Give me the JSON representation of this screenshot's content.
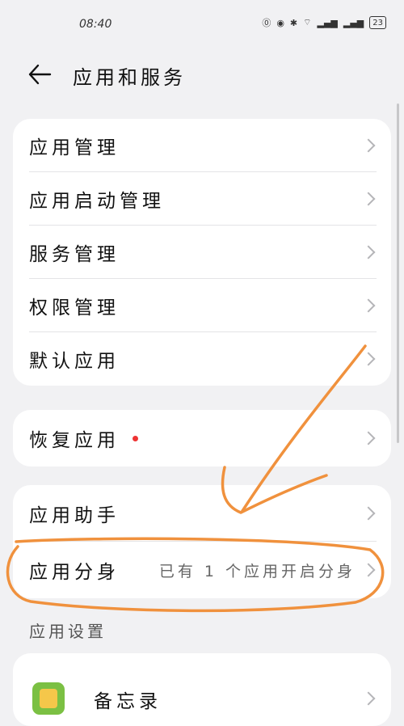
{
  "status": {
    "time": "08:40",
    "battery": "23"
  },
  "header": {
    "title": "应用和服务"
  },
  "group1": [
    {
      "label": "应用管理"
    },
    {
      "label": "应用启动管理"
    },
    {
      "label": "服务管理"
    },
    {
      "label": "权限管理"
    },
    {
      "label": "默认应用"
    }
  ],
  "group2": [
    {
      "label": "恢复应用"
    }
  ],
  "group3": [
    {
      "label": "应用助手"
    },
    {
      "label": "应用分身",
      "value": "已有 1 个应用开启分身"
    }
  ],
  "section": {
    "title": "应用设置"
  },
  "apps": [
    {
      "label": "备忘录"
    }
  ],
  "colors": {
    "annotation": "#f0913d",
    "badge": "#e33333"
  }
}
